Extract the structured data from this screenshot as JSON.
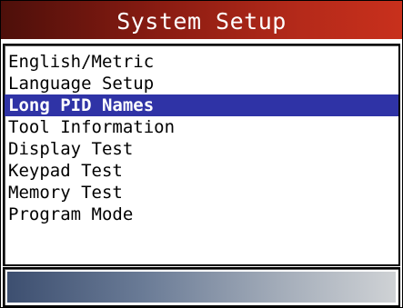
{
  "header": {
    "title": "System Setup"
  },
  "menu": {
    "selected_index": 2,
    "items": [
      {
        "label": "English/Metric"
      },
      {
        "label": "Language Setup"
      },
      {
        "label": "Long PID Names"
      },
      {
        "label": "Tool Information"
      },
      {
        "label": "Display Test"
      },
      {
        "label": "Keypad Test"
      },
      {
        "label": "Memory Test"
      },
      {
        "label": "Program Mode"
      }
    ]
  },
  "colors": {
    "title_bar": "#b52a1a",
    "title_text": "#ffffff",
    "highlight": "#2f33a6",
    "highlight_text": "#ffffff",
    "status_bar_start": "#3d4f70",
    "status_bar_end": "#cfd2d5"
  }
}
